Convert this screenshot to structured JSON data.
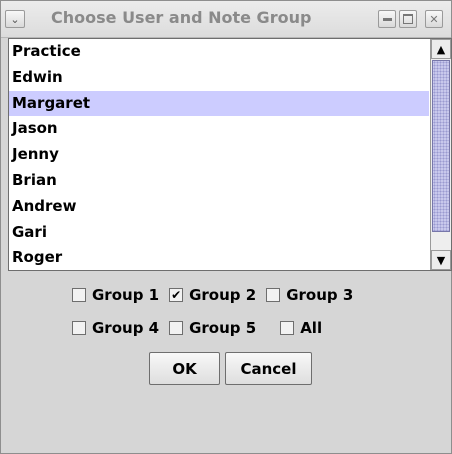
{
  "window": {
    "title": "Choose User and Note Group",
    "menu_icon": "chevron-down-icon",
    "controls": [
      "minimize-icon",
      "maximize-icon",
      "close-icon"
    ]
  },
  "user_list": {
    "selected": "Margaret",
    "items": [
      "Practice",
      "Edwin",
      "Margaret",
      "Jason",
      "Jenny",
      "Brian",
      "Andrew",
      "Gari",
      "Roger"
    ]
  },
  "groups": {
    "row1": [
      {
        "label": "Group 1",
        "checked": false
      },
      {
        "label": "Group 2",
        "checked": true
      },
      {
        "label": "Group 3",
        "checked": false
      }
    ],
    "row2": [
      {
        "label": "Group 4",
        "checked": false
      },
      {
        "label": "Group 5",
        "checked": false
      },
      {
        "label": "All",
        "checked": false
      }
    ]
  },
  "buttons": {
    "ok_label": "OK",
    "cancel_label": "Cancel"
  },
  "colors": {
    "selection": "#ccccff",
    "window_bg": "#d6d6d6",
    "scroll_thumb": "#c8c8ec"
  }
}
